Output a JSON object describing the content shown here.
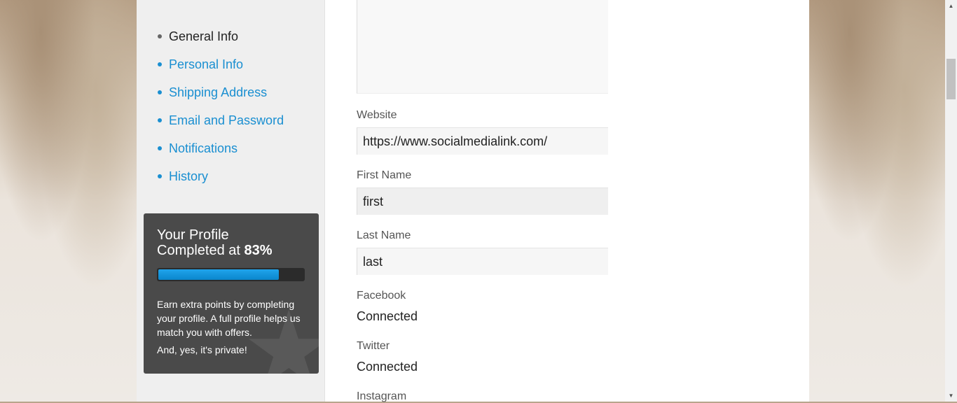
{
  "sidebar": {
    "items": [
      {
        "label": "General Info",
        "active": true
      },
      {
        "label": "Personal Info",
        "active": false
      },
      {
        "label": "Shipping Address",
        "active": false
      },
      {
        "label": "Email and Password",
        "active": false
      },
      {
        "label": "Notifications",
        "active": false
      },
      {
        "label": "History",
        "active": false
      }
    ]
  },
  "profile": {
    "title_line1": "Your Profile",
    "title_line2": "Completed at ",
    "percent_text": "83%",
    "percent": 83,
    "text1": "Earn extra points by completing your profile. A full profile helps us match you with offers.",
    "text2": "And, yes, it's private!",
    "star_icon": "star-icon"
  },
  "form": {
    "website": {
      "label": "Website",
      "value": "https://www.socialmedialink.com/"
    },
    "first_name": {
      "label": "First Name",
      "value": "first"
    },
    "last_name": {
      "label": "Last Name",
      "value": "last"
    },
    "facebook": {
      "label": "Facebook",
      "value": "Connected"
    },
    "twitter": {
      "label": "Twitter",
      "value": "Connected"
    },
    "instagram": {
      "label": "Instagram"
    }
  },
  "colors": {
    "link": "#1a8fd1",
    "progress": "#0a86cc",
    "profile_box": "#4a4a4a"
  }
}
